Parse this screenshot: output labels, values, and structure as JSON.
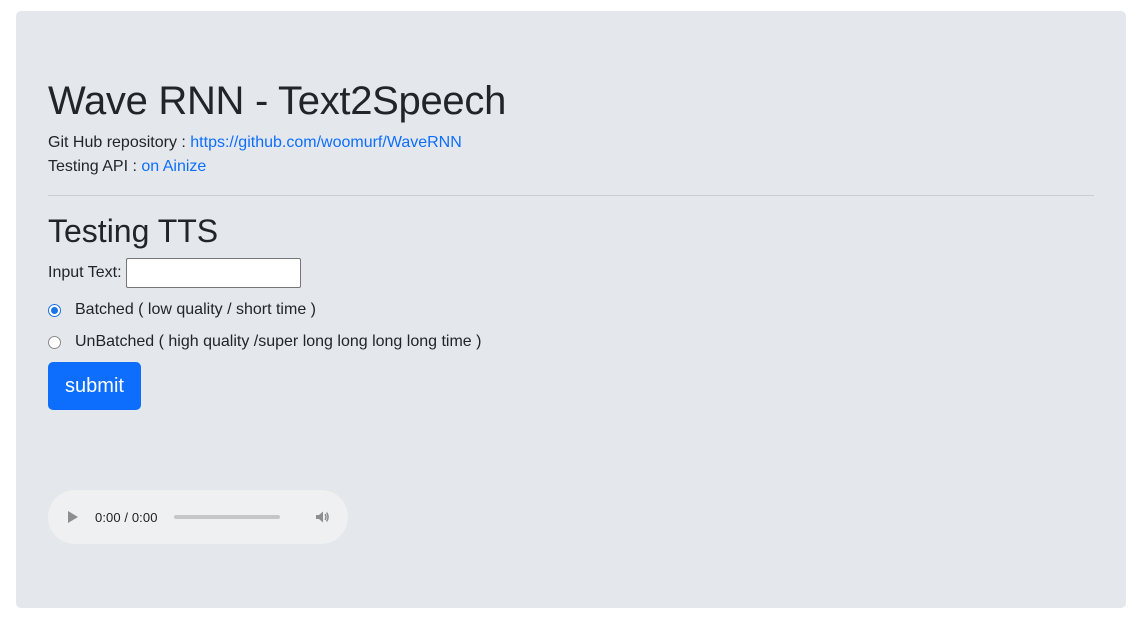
{
  "header": {
    "title": "Wave RNN - Text2Speech",
    "repo_label": "Git Hub repository :",
    "repo_link": "https://github.com/woomurf/WaveRNN",
    "api_label": "Testing API :",
    "api_link": "on Ainize"
  },
  "form": {
    "section_title": "Testing TTS",
    "input_label": "Input Text:",
    "input_value": "",
    "options": [
      {
        "label": "Batched ( low quality / short time )",
        "checked": true
      },
      {
        "label": "UnBatched ( high quality /super long long long long time )",
        "checked": false
      }
    ],
    "submit_label": "submit"
  },
  "audio_player": {
    "time": "0:00 / 0:00",
    "play_icon": "play-icon",
    "volume_icon": "volume-icon",
    "progress": 0
  },
  "colors": {
    "panel_bg": "#e4e8ec",
    "accent": "#0d6efd",
    "radio_accent": "#1a73e8"
  }
}
